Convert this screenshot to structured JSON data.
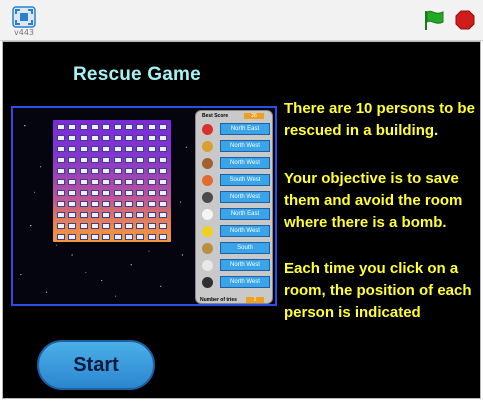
{
  "toolbar": {
    "version": "v443",
    "icons": {
      "fullscreen": "fullscreen-icon",
      "flag": "green-flag-icon",
      "stop": "stop-icon"
    },
    "colors": {
      "flag": "#22a822",
      "stop": "#d01c1c"
    }
  },
  "stage": {
    "title": "Rescue Game",
    "instructions": [
      "There are 10 persons to be rescued in a building.",
      "Your objective is to save them and avoid the room where there is a bomb.",
      "Each time you click on a room, the position of each person is indicated"
    ],
    "start_label": "Start",
    "colors": {
      "title": "#a6f2f2",
      "text": "#ffff33",
      "button": "#3a9ee0"
    }
  },
  "preview": {
    "best_score_label": "Best Score",
    "best_score_value": "26",
    "tries_label": "Number of tries",
    "tries_value": "2",
    "persons": [
      {
        "direction": "North East",
        "color": "#d83030"
      },
      {
        "direction": "North West",
        "color": "#d8a030"
      },
      {
        "direction": "North West",
        "color": "#a06030"
      },
      {
        "direction": "South West",
        "color": "#e06a30"
      },
      {
        "direction": "North West",
        "color": "#4a4a4a"
      },
      {
        "direction": "North East",
        "color": "#f4f4f4"
      },
      {
        "direction": "North West",
        "color": "#f0d020"
      },
      {
        "direction": "South",
        "color": "#b89040"
      },
      {
        "direction": "North West",
        "color": "#e8e8e8"
      },
      {
        "direction": "North West",
        "color": "#303030"
      }
    ]
  }
}
